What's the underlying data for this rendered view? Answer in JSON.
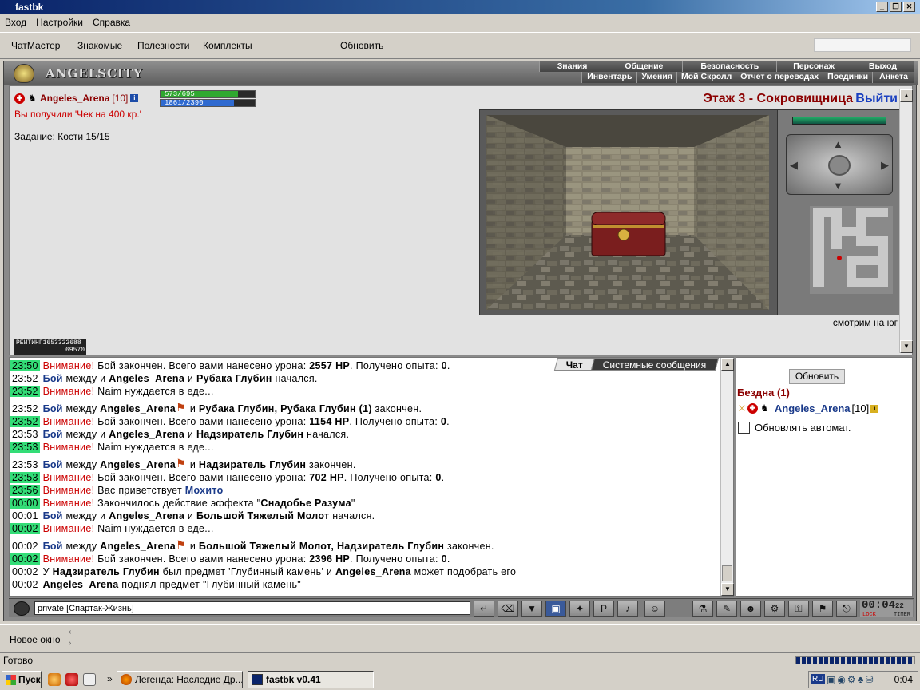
{
  "window": {
    "title": "fastbk",
    "controls": [
      "_",
      "❐",
      "✕"
    ]
  },
  "menu": [
    "Вход",
    "Настройки",
    "Справка"
  ],
  "toolbar": {
    "chatmaster": "ЧатМастер",
    "friends": "Знакомые",
    "useful": "Полезности",
    "sets": "Комплекты",
    "refresh": "Обновить",
    "search_value": ""
  },
  "header": {
    "logo": "ANGELSCITY",
    "nav_top": [
      "Знания",
      "Общение",
      "Безопасность",
      "Персонаж",
      "Выход"
    ],
    "nav_bottom": [
      "Инвентарь",
      "Умения",
      "Мой Скролл",
      "Отчет о переводах",
      "Поединки",
      "Анкета"
    ]
  },
  "character": {
    "name": "Angeles_Arena",
    "level": "[10]",
    "hp_text": "573/695",
    "hp_fraction": 0.82,
    "mp_text": "1861/2390",
    "mp_fraction": 0.78
  },
  "main": {
    "received": "Вы получили 'Чек на 400 кр.'",
    "task": "Задание: Кости 15/15",
    "floor": "Этаж 3 - Сокровищница",
    "exit": "Выйти",
    "looking": "смотрим на юг",
    "rating_label": "РЕЙТИНГ",
    "rating_value": "1653322688",
    "rating_sub": "69570"
  },
  "chat": {
    "tabs": [
      "Чат",
      "Системные сообщения"
    ],
    "lines": [
      {
        "time": "23:50",
        "green": true,
        "parts": [
          [
            "att",
            "Внимание!"
          ],
          [
            "t",
            " Бой закончен. Всего вами нанесено урона: "
          ],
          [
            "b",
            "2557 HP"
          ],
          [
            "t",
            ". Получено опыта: "
          ],
          [
            "b",
            "0"
          ],
          [
            "t",
            "."
          ]
        ]
      },
      {
        "time": "23:52",
        "green": false,
        "parts": [
          [
            "boy",
            "Бой"
          ],
          [
            "t",
            " между и "
          ],
          [
            "b",
            "Angeles_Arena"
          ],
          [
            "t",
            " и "
          ],
          [
            "b",
            "Рубака Глубин"
          ],
          [
            "t",
            " начался."
          ]
        ]
      },
      {
        "time": "23:52",
        "green": true,
        "parts": [
          [
            "att",
            "Внимание!"
          ],
          [
            "t",
            " Naim нуждается в еде..."
          ]
        ]
      },
      {
        "time": "23:52",
        "green": false,
        "gap": true,
        "parts": [
          [
            "boy",
            "Бой"
          ],
          [
            "t",
            " между "
          ],
          [
            "b",
            "Angeles_Arena"
          ],
          [
            "sw",
            ""
          ],
          [
            "t",
            " и "
          ],
          [
            "b",
            "Рубака Глубин, Рубака Глубин (1)"
          ],
          [
            "t",
            " закончен."
          ]
        ]
      },
      {
        "time": "23:52",
        "green": true,
        "parts": [
          [
            "att",
            "Внимание!"
          ],
          [
            "t",
            " Бой закончен. Всего вами нанесено урона: "
          ],
          [
            "b",
            "1154 HP"
          ],
          [
            "t",
            ". Получено опыта: "
          ],
          [
            "b",
            "0"
          ],
          [
            "t",
            "."
          ]
        ]
      },
      {
        "time": "23:53",
        "green": false,
        "parts": [
          [
            "boy",
            "Бой"
          ],
          [
            "t",
            " между и "
          ],
          [
            "b",
            "Angeles_Arena"
          ],
          [
            "t",
            " и "
          ],
          [
            "b",
            "Надзиратель Глубин"
          ],
          [
            "t",
            " начался."
          ]
        ]
      },
      {
        "time": "23:53",
        "green": true,
        "parts": [
          [
            "att",
            "Внимание!"
          ],
          [
            "t",
            " Naim нуждается в еде..."
          ]
        ]
      },
      {
        "time": "23:53",
        "green": false,
        "gap": true,
        "parts": [
          [
            "boy",
            "Бой"
          ],
          [
            "t",
            " между "
          ],
          [
            "b",
            "Angeles_Arena"
          ],
          [
            "sw",
            ""
          ],
          [
            "t",
            " и "
          ],
          [
            "b",
            "Надзиратель Глубин"
          ],
          [
            "t",
            " закончен."
          ]
        ]
      },
      {
        "time": "23:53",
        "green": true,
        "parts": [
          [
            "att",
            "Внимание!"
          ],
          [
            "t",
            " Бой закончен. Всего вами нанесено урона: "
          ],
          [
            "b",
            "702 HP"
          ],
          [
            "t",
            ". Получено опыта: "
          ],
          [
            "b",
            "0"
          ],
          [
            "t",
            "."
          ]
        ]
      },
      {
        "time": "23:56",
        "green": true,
        "parts": [
          [
            "att",
            "Внимание!"
          ],
          [
            "t",
            " Вас приветствует "
          ],
          [
            "blue",
            "Мохито"
          ]
        ]
      },
      {
        "time": "00:00",
        "green": true,
        "parts": [
          [
            "att",
            "Внимание!"
          ],
          [
            "t",
            " Закончилось действие эффекта \""
          ],
          [
            "b",
            "Снадобье Разума"
          ],
          [
            "t",
            "\""
          ]
        ]
      },
      {
        "time": "00:01",
        "green": false,
        "parts": [
          [
            "boy",
            "Бой"
          ],
          [
            "t",
            " между и "
          ],
          [
            "b",
            "Angeles_Arena"
          ],
          [
            "t",
            " и "
          ],
          [
            "b",
            "Большой Тяжелый Молот"
          ],
          [
            "t",
            " начался."
          ]
        ]
      },
      {
        "time": "00:02",
        "green": true,
        "parts": [
          [
            "att",
            "Внимание!"
          ],
          [
            "t",
            " Naim нуждается в еде..."
          ]
        ]
      },
      {
        "time": "00:02",
        "green": false,
        "gap": true,
        "parts": [
          [
            "boy",
            "Бой"
          ],
          [
            "t",
            " между "
          ],
          [
            "b",
            "Angeles_Arena"
          ],
          [
            "sw",
            ""
          ],
          [
            "t",
            " и "
          ],
          [
            "b",
            "Большой Тяжелый Молот, Надзиратель Глубин"
          ],
          [
            "t",
            " закончен."
          ]
        ]
      },
      {
        "time": "00:02",
        "green": true,
        "parts": [
          [
            "att",
            "Внимание!"
          ],
          [
            "t",
            " Бой закончен. Всего вами нанесено урона: "
          ],
          [
            "b",
            "2396 HP"
          ],
          [
            "t",
            ". Получено опыта: "
          ],
          [
            "b",
            "0"
          ],
          [
            "t",
            "."
          ]
        ]
      },
      {
        "time": "00:02",
        "green": false,
        "parts": [
          [
            "t",
            "У "
          ],
          [
            "b",
            "Надзиратель Глубин"
          ],
          [
            "t",
            " был предмет 'Глубинный камень' и "
          ],
          [
            "b",
            "Angeles_Arena"
          ],
          [
            "t",
            " может подобрать его"
          ]
        ]
      },
      {
        "time": "00:02",
        "green": false,
        "parts": [
          [
            "b",
            "Angeles_Arena"
          ],
          [
            "t",
            " поднял предмет \"Глубинный камень\""
          ]
        ]
      }
    ],
    "input_value": "private [Спартак-Жизнь] "
  },
  "side": {
    "refresh": "Обновить",
    "location": "Бездна (1)",
    "user_name": "Angeles_Arena",
    "user_level": "[10]",
    "auto_label": "Обновлять автомат."
  },
  "clock": {
    "time": "00:04",
    "sec": "22",
    "lock": "LOCK",
    "timer": "TIMER"
  },
  "bottom": {
    "new_window": "Новое окно",
    "status": "Готово"
  },
  "taskbar": {
    "start": "Пуск",
    "task1": "Легенда: Наследие Др...",
    "task2": "fastbk v0.41",
    "lang": "RU",
    "time": "0:04"
  }
}
